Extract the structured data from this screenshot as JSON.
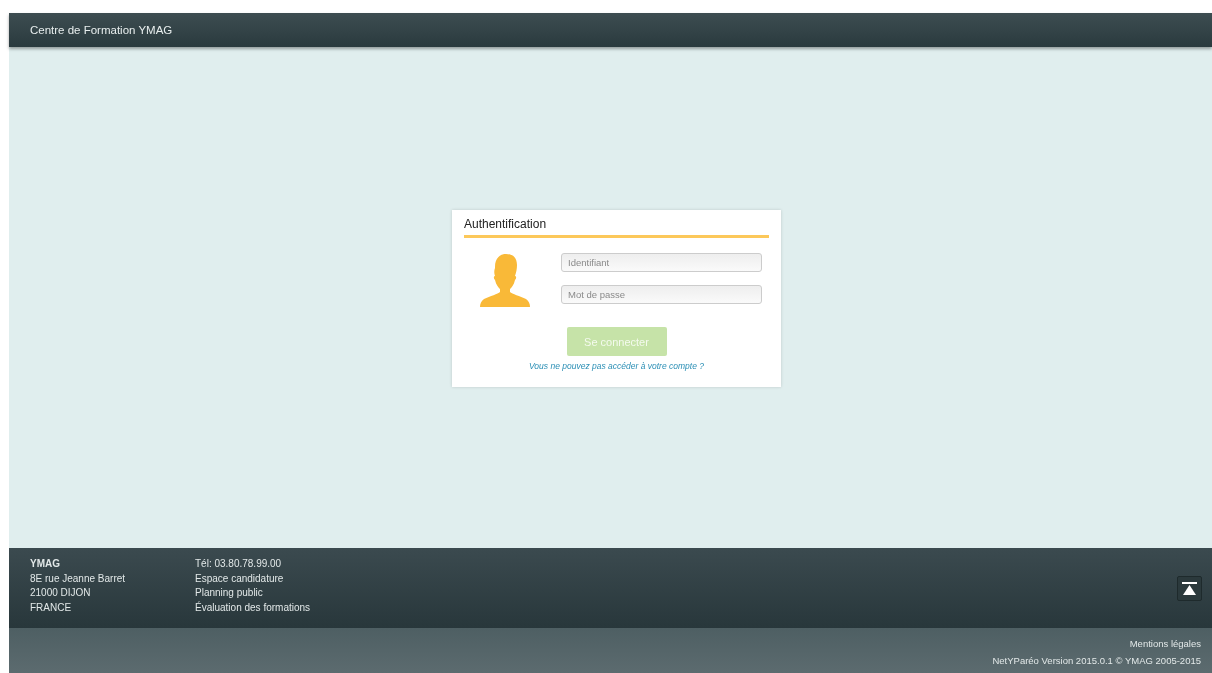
{
  "header": {
    "title": "Centre de Formation YMAG"
  },
  "login": {
    "title": "Authentification",
    "fields": [
      {
        "placeholder": "Identifiant"
      },
      {
        "placeholder": "Mot de passe"
      }
    ],
    "button": {
      "label": "Se connecter",
      "disabled": true
    },
    "help_link": "Vous ne pouvez pas accéder à votre compte ?"
  },
  "footer": {
    "address": [
      {
        "text": "YMAG",
        "kind": "name"
      },
      {
        "text": "8E rue Jeanne Barret",
        "kind": "line"
      },
      {
        "text": "21000 DIJON",
        "kind": "line"
      },
      {
        "text": "FRANCE",
        "kind": "line"
      }
    ],
    "contacts": [
      "Tél: 03.80.78.99.00",
      "Espace candidature",
      "Planning public",
      "Évaluation des formations"
    ]
  },
  "bottom_bar": {
    "legal_link": "Mentions légales",
    "version": "NetYParéo Version 2015.0.1 © YMAG 2005-2015"
  }
}
